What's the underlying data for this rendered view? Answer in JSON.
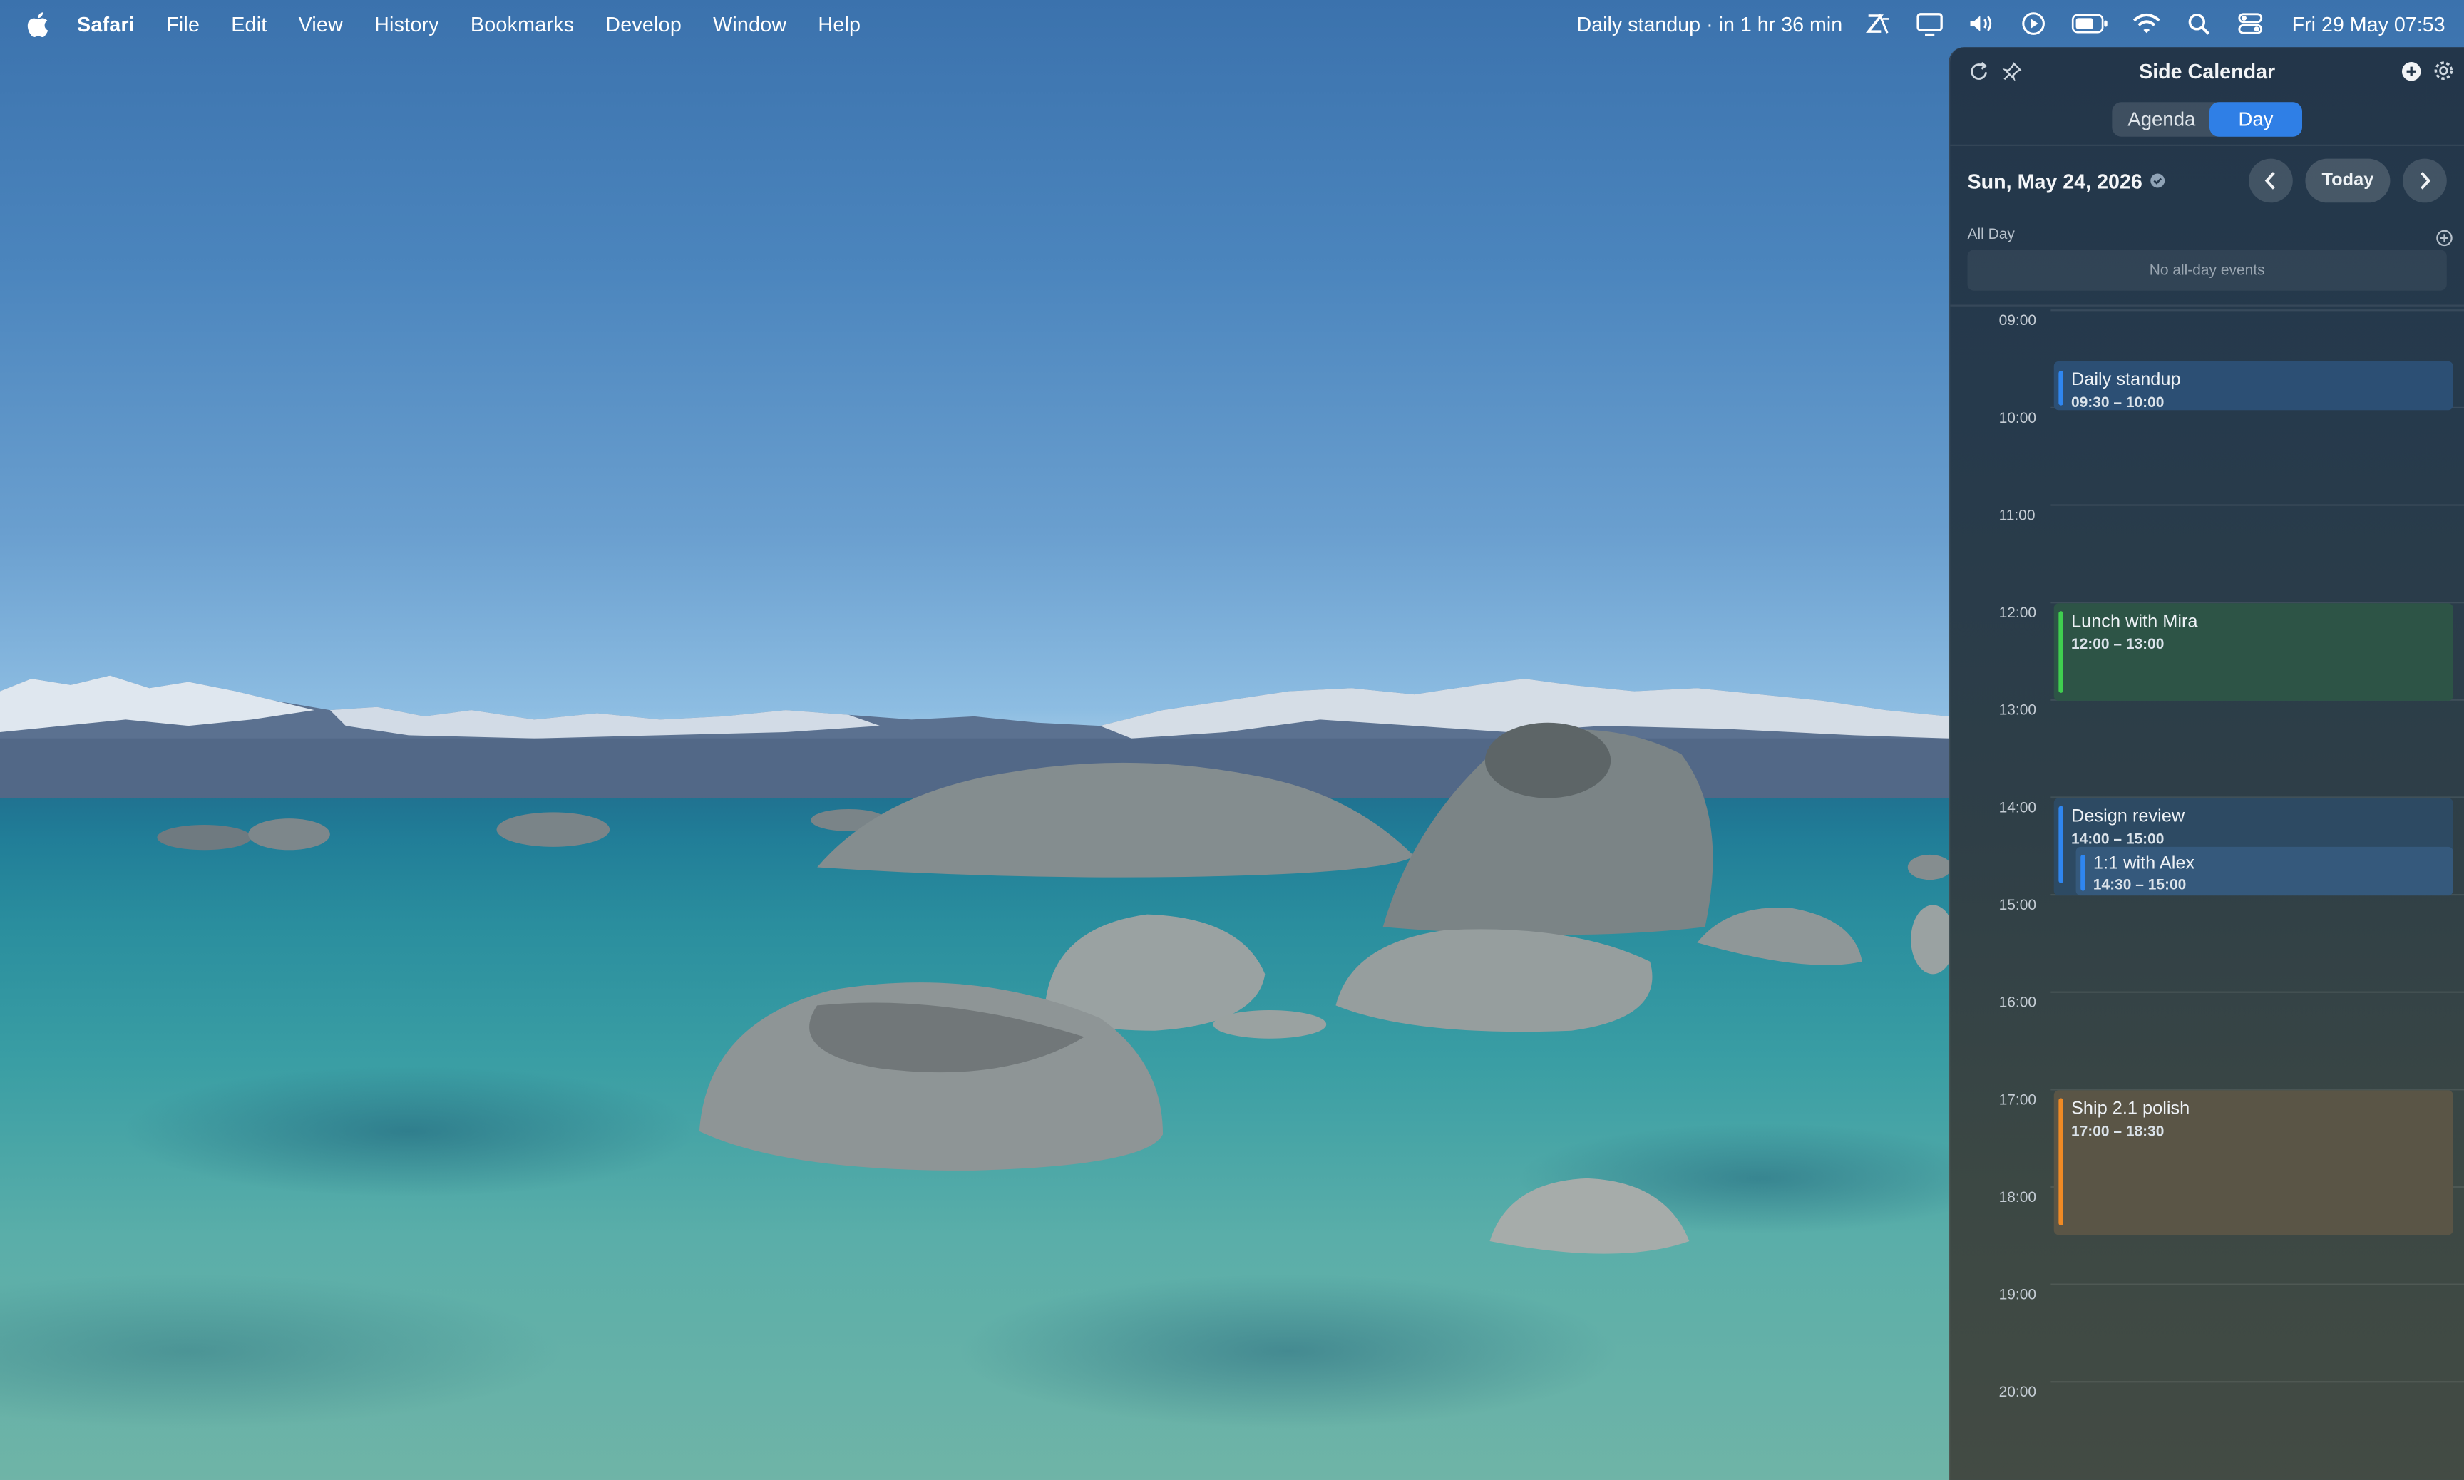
{
  "menubar": {
    "app_name": "Safari",
    "menus": [
      "File",
      "Edit",
      "View",
      "History",
      "Bookmarks",
      "Develop",
      "Window",
      "Help"
    ],
    "status_text": "Daily standup · in 1 hr 36 min",
    "clock": "Fri 29 May  07:53",
    "icons": [
      "focus-icon",
      "display-icon",
      "volume-icon",
      "play-icon",
      "battery-icon",
      "wifi-icon",
      "search-icon",
      "control-center-icon"
    ]
  },
  "panel": {
    "title": "Side Calendar",
    "tabs": [
      "Agenda",
      "Day"
    ],
    "active_tab": "Day",
    "date": "Sun, May 24, 2026",
    "today_label": "Today",
    "all_day_label": "All Day",
    "no_all_day_text": "No all-day events",
    "hours": [
      "09:00",
      "10:00",
      "11:00",
      "12:00",
      "13:00",
      "14:00",
      "15:00",
      "16:00",
      "17:00",
      "18:00",
      "19:00",
      "20:00"
    ],
    "events": [
      {
        "title": "Daily standup",
        "time": "09:30 – 10:00",
        "color": "#2f86f0"
      },
      {
        "title": "Lunch with Mira",
        "time": "12:00 – 13:00",
        "color": "#3fcf4f"
      },
      {
        "title": "Design review",
        "time": "14:00 – 15:00",
        "color": "#2f86f0"
      },
      {
        "title": "1:1 with Alex",
        "time": "14:30 – 15:00",
        "color": "#2f86f0"
      },
      {
        "title": "Ship 2.1 polish",
        "time": "17:00 – 18:30",
        "color": "#f08a24"
      }
    ],
    "accent_color": "#2f7fe6"
  }
}
